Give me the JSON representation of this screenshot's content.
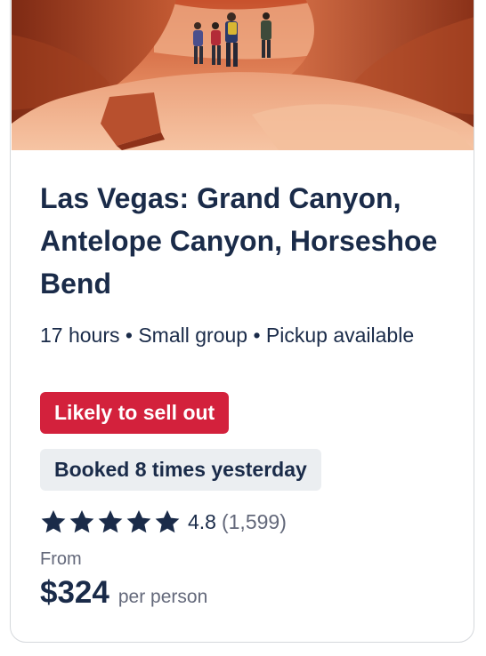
{
  "card": {
    "image_alt": "Hikers walking through the orange sandstone walls of Antelope Canyon",
    "title": "Las Vegas: Grand Canyon, Antelope Canyon, Horseshoe Bend",
    "meta": "17 hours • Small group • Pickup available",
    "badge_scarcity": "Likely to sell out",
    "badge_booked": "Booked 8 times yesterday",
    "rating": {
      "value": "4.8",
      "count": "(1,599)",
      "stars_filled": 5,
      "stars_total": 5
    },
    "price": {
      "from_label": "From",
      "amount": "$324",
      "unit": "per person"
    }
  },
  "colors": {
    "text_primary": "#1a2b49",
    "text_secondary": "#63687a",
    "badge_red": "#d3213c",
    "badge_grey": "#ebeef1"
  },
  "icons": {
    "star": "star-icon"
  }
}
